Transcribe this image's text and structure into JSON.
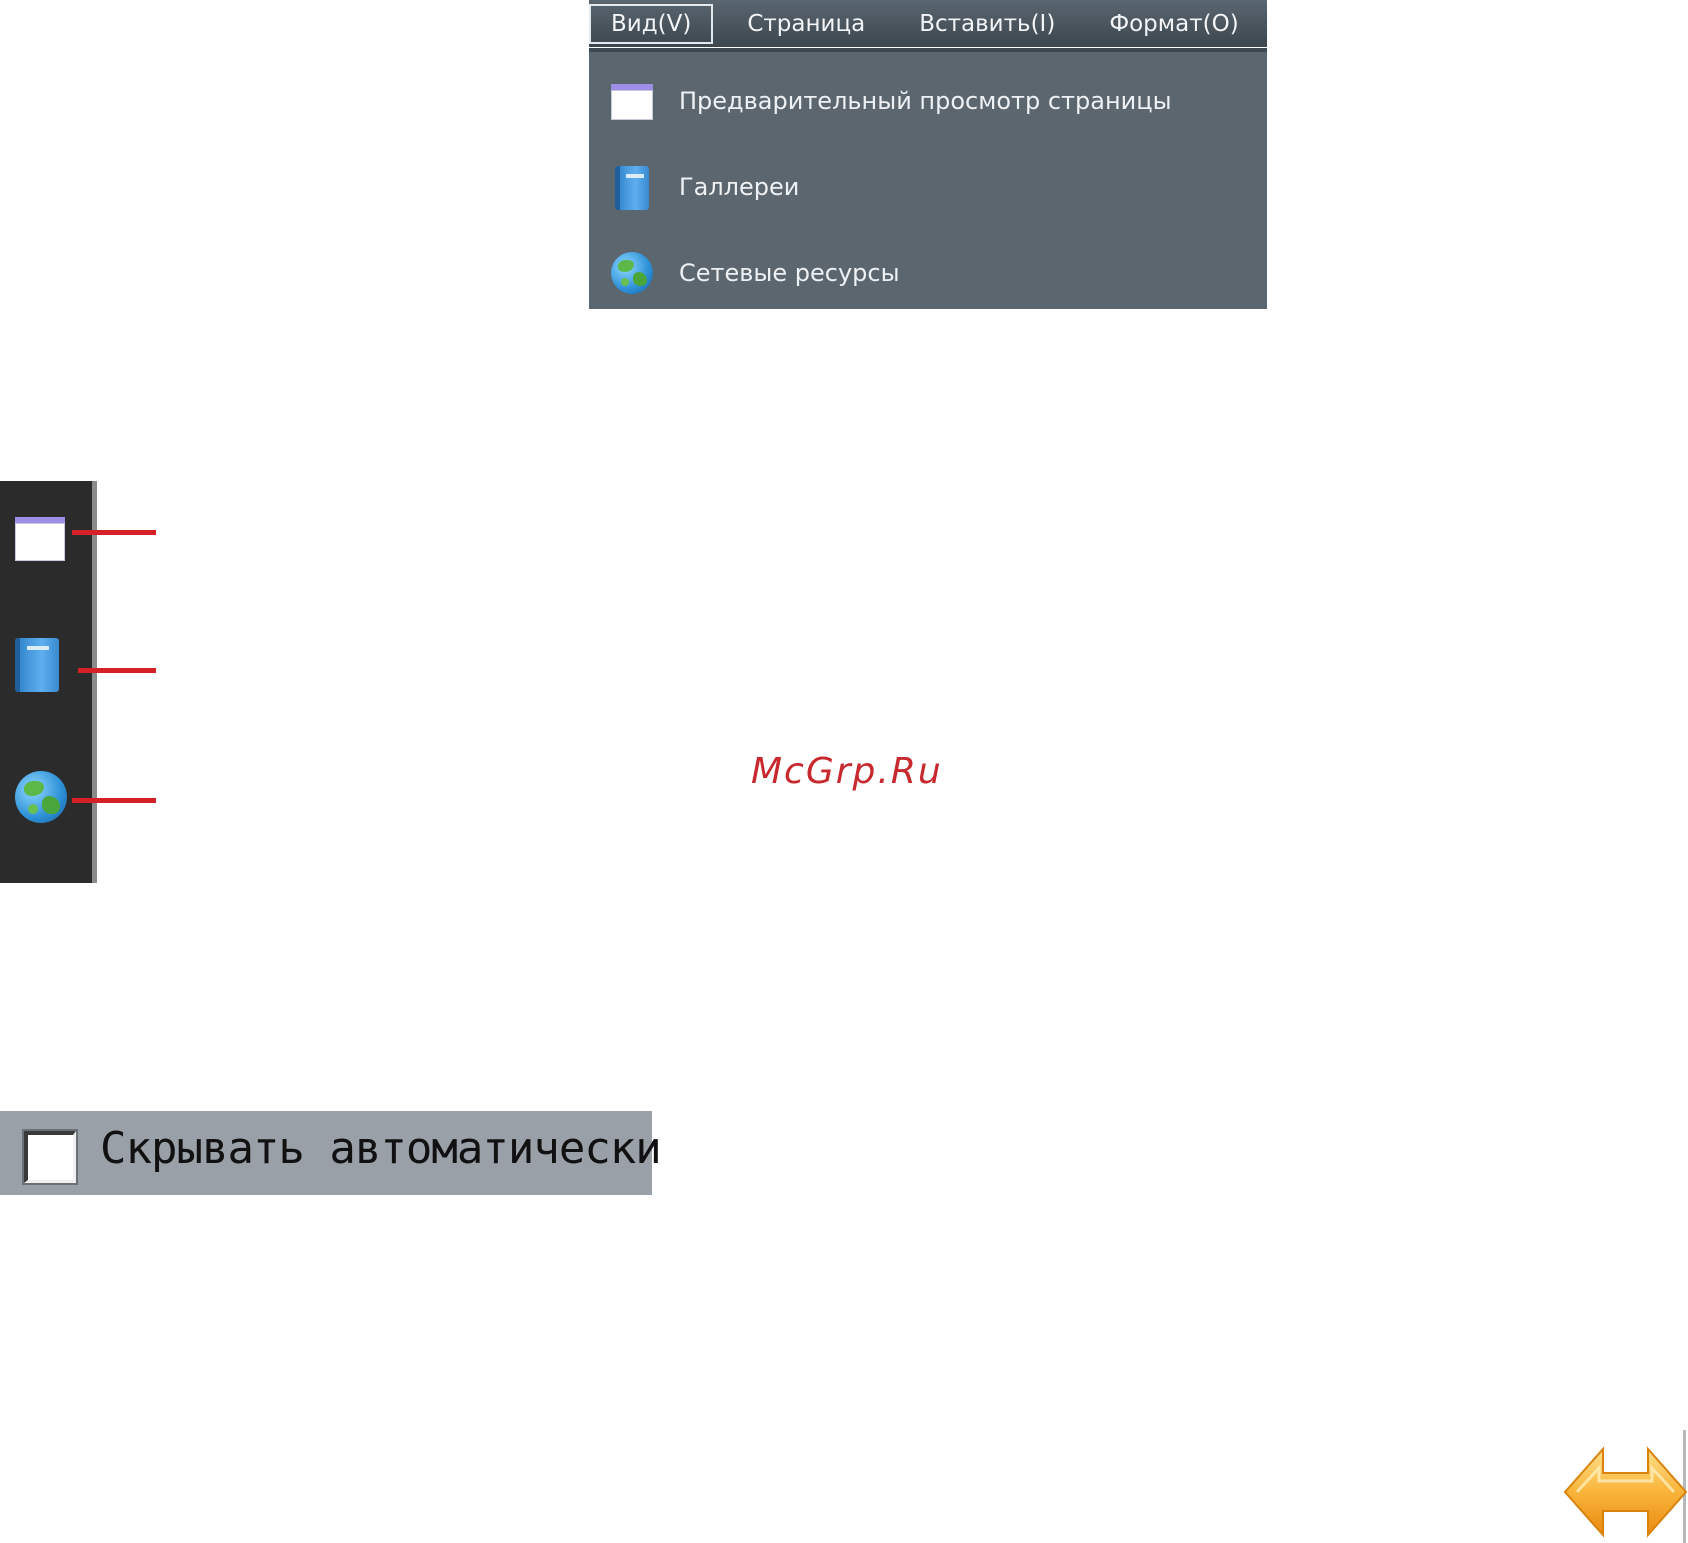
{
  "menubar": {
    "items": [
      "Вид(V)",
      "Страница",
      "Вставить(I)",
      "Формат(O)"
    ],
    "active_index": 0
  },
  "dropdown": {
    "items": [
      {
        "icon": "window-icon",
        "label": "Предварительный просмотр страницы"
      },
      {
        "icon": "book-icon",
        "label": "Галлереи"
      },
      {
        "icon": "globe-icon",
        "label": "Сетевые ресурсы"
      }
    ]
  },
  "sidebar": {
    "icons": [
      "window-icon",
      "book-icon",
      "globe-icon"
    ]
  },
  "watermark": "McGrp.Ru",
  "autohide": {
    "label": "Скрывать автоматически",
    "checked": false
  },
  "colors": {
    "menu_bg": "#4a555d",
    "dropdown_bg": "#5b666e",
    "sidebar_bg": "#2b2b2b",
    "callout": "#d42128",
    "watermark": "#c8292f",
    "checkbox_bar": "#9aa0a7",
    "arrow": "#f5a623"
  }
}
